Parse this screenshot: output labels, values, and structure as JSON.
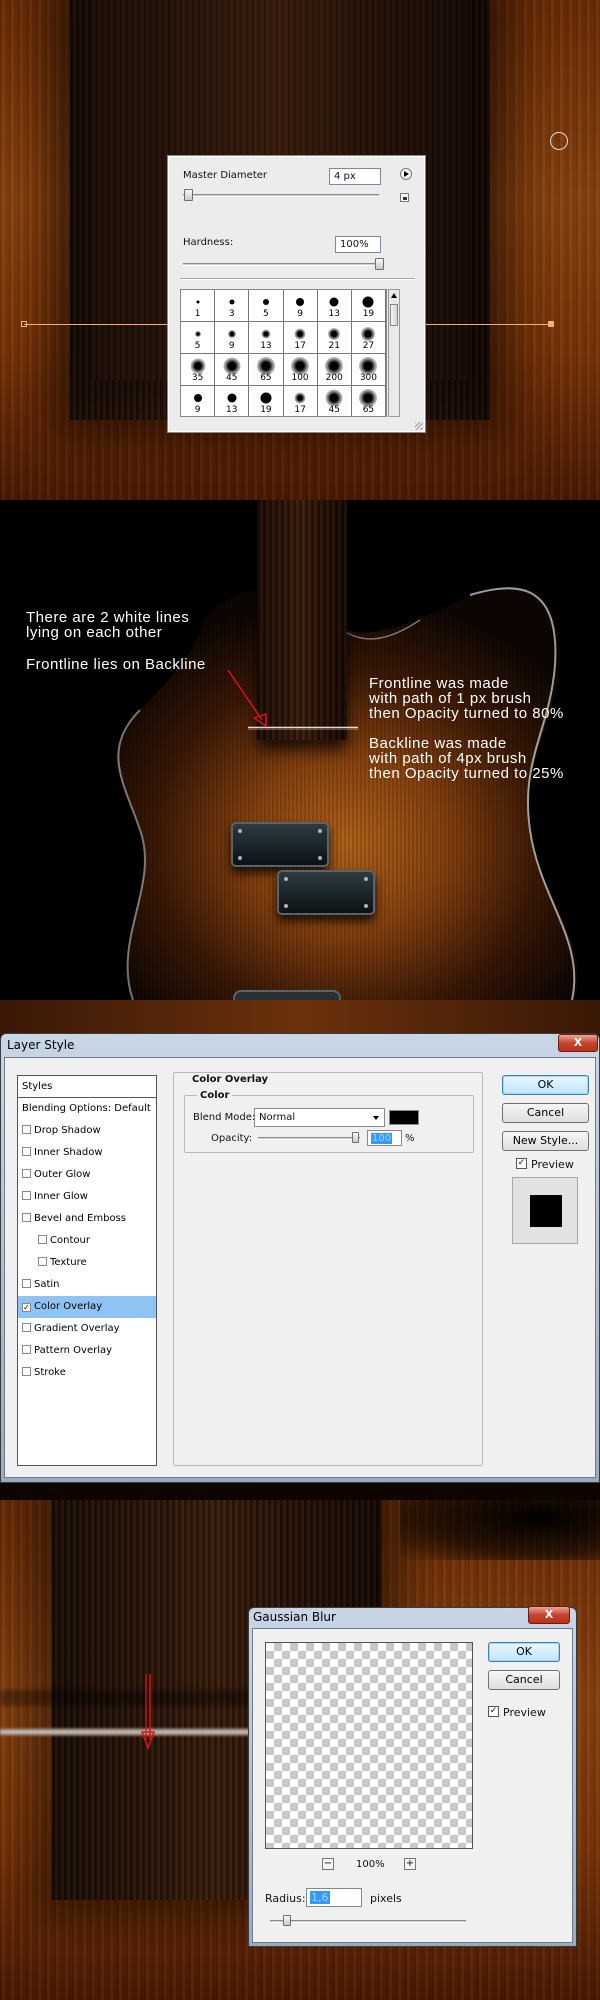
{
  "brush_panel": {
    "master_diameter_label": "Master Diameter",
    "master_diameter_value": "4 px",
    "hardness_label": "Hardness:",
    "hardness_value": "100%",
    "brushes": [
      {
        "size": "1",
        "soft": false
      },
      {
        "size": "3",
        "soft": false
      },
      {
        "size": "5",
        "soft": false
      },
      {
        "size": "9",
        "soft": false
      },
      {
        "size": "13",
        "soft": false
      },
      {
        "size": "19",
        "soft": false
      },
      {
        "size": "5",
        "soft": true
      },
      {
        "size": "9",
        "soft": true
      },
      {
        "size": "13",
        "soft": true
      },
      {
        "size": "17",
        "soft": true
      },
      {
        "size": "21",
        "soft": true
      },
      {
        "size": "27",
        "soft": true
      },
      {
        "size": "35",
        "soft": true
      },
      {
        "size": "45",
        "soft": true
      },
      {
        "size": "65",
        "soft": true
      },
      {
        "size": "100",
        "soft": true
      },
      {
        "size": "200",
        "soft": true
      },
      {
        "size": "300",
        "soft": true
      },
      {
        "size": "9",
        "soft": false
      },
      {
        "size": "13",
        "soft": false
      },
      {
        "size": "19",
        "soft": false
      },
      {
        "size": "17",
        "soft": true
      },
      {
        "size": "45",
        "soft": true
      },
      {
        "size": "65",
        "soft": true
      }
    ]
  },
  "annotations": {
    "left_line1": "There are 2 white lines",
    "left_line2": "lying on each other",
    "left_line3": "Frontline lies on Backline",
    "right_line1": "Frontline was made",
    "right_line2": "with path of 1 px brush",
    "right_line3": "then Opacity turned to 80%",
    "right_line4": "Backline was made",
    "right_line5": "with path of 4px brush",
    "right_line6": "then Opacity turned to 25%"
  },
  "layer_style": {
    "title": "Layer Style",
    "close": "X",
    "styles_items": [
      {
        "label": "Styles",
        "checkbox": false,
        "checked": false,
        "indent": false,
        "selected": false
      },
      {
        "label": "Blending Options: Default",
        "checkbox": false,
        "checked": false,
        "indent": false,
        "selected": false
      },
      {
        "label": "Drop Shadow",
        "checkbox": true,
        "checked": false,
        "indent": false,
        "selected": false
      },
      {
        "label": "Inner Shadow",
        "checkbox": true,
        "checked": false,
        "indent": false,
        "selected": false
      },
      {
        "label": "Outer Glow",
        "checkbox": true,
        "checked": false,
        "indent": false,
        "selected": false
      },
      {
        "label": "Inner Glow",
        "checkbox": true,
        "checked": false,
        "indent": false,
        "selected": false
      },
      {
        "label": "Bevel and Emboss",
        "checkbox": true,
        "checked": false,
        "indent": false,
        "selected": false
      },
      {
        "label": "Contour",
        "checkbox": true,
        "checked": false,
        "indent": true,
        "selected": false
      },
      {
        "label": "Texture",
        "checkbox": true,
        "checked": false,
        "indent": true,
        "selected": false
      },
      {
        "label": "Satin",
        "checkbox": true,
        "checked": false,
        "indent": false,
        "selected": false
      },
      {
        "label": "Color Overlay",
        "checkbox": true,
        "checked": true,
        "indent": false,
        "selected": true
      },
      {
        "label": "Gradient Overlay",
        "checkbox": true,
        "checked": false,
        "indent": false,
        "selected": false
      },
      {
        "label": "Pattern Overlay",
        "checkbox": true,
        "checked": false,
        "indent": false,
        "selected": false
      },
      {
        "label": "Stroke",
        "checkbox": true,
        "checked": false,
        "indent": false,
        "selected": false
      }
    ],
    "section_title": "Color Overlay",
    "group_title": "Color",
    "blend_mode_label": "Blend Mode:",
    "blend_mode_value": "Normal",
    "overlay_color": "#000000",
    "opacity_label": "Opacity:",
    "opacity_value": "100",
    "opacity_unit": "%",
    "ok": "OK",
    "cancel": "Cancel",
    "new_style": "New Style...",
    "preview": "Preview",
    "preview_checked": true
  },
  "gaussian_blur": {
    "title": "Gaussian Blur",
    "close": "X",
    "ok": "OK",
    "cancel": "Cancel",
    "preview": "Preview",
    "preview_checked": true,
    "zoom_minus": "−",
    "zoom_value": "100%",
    "zoom_plus": "+",
    "radius_label": "Radius:",
    "radius_value": "1,6",
    "radius_unit": "pixels"
  },
  "colors": {
    "selection_blue": "#8fc3f3",
    "annotation_red": "#e01010",
    "guide_orange": "#f4b070"
  }
}
